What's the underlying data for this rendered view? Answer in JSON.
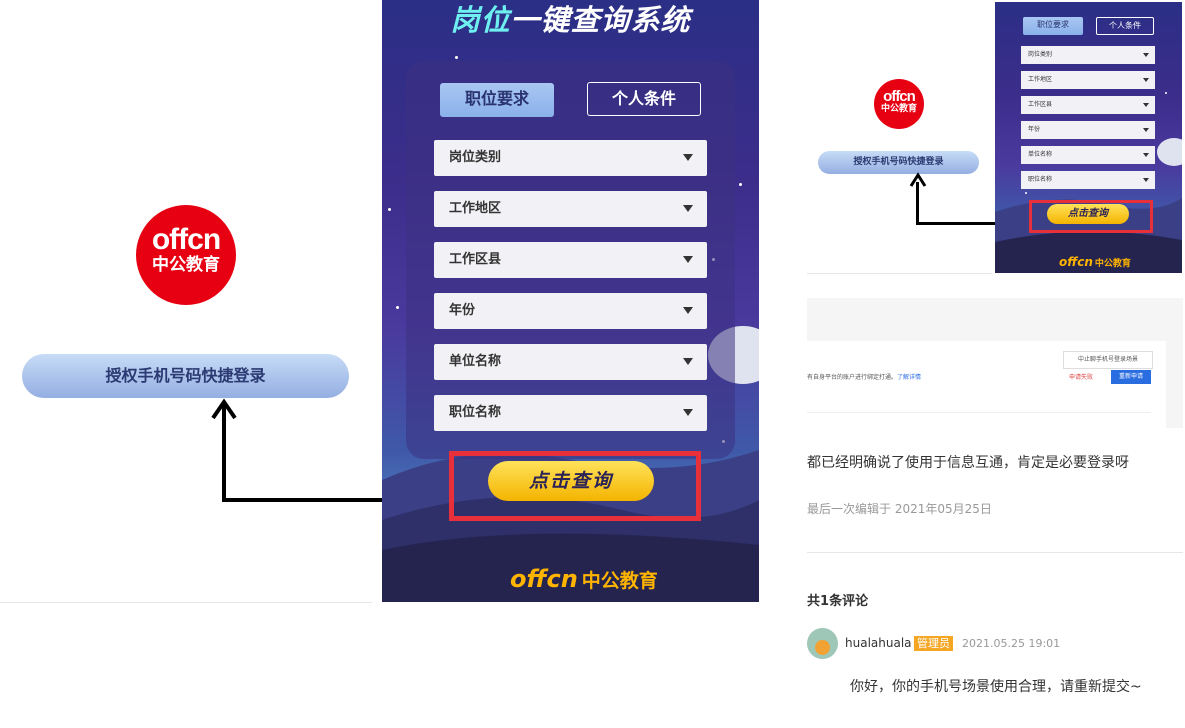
{
  "left": {
    "logo_en": "offcn",
    "logo_cn": "中公教育",
    "auth_label": "授权手机号码快捷登录"
  },
  "phone": {
    "title_highlight": "岗位",
    "title_rest": "一键查询系统",
    "tabs": [
      "职位要求",
      "个人条件"
    ],
    "selects": [
      "岗位类别",
      "工作地区",
      "工作区县",
      "年份",
      "单位名称",
      "职位名称"
    ],
    "query_label": "点击查询",
    "bottom_logo_en": "offcn",
    "bottom_logo_cn": "中公教育"
  },
  "thumb": {
    "logo_en": "offcn",
    "logo_cn": "中公教育",
    "auth_label": "授权手机号码快捷登录",
    "tabs": [
      "职位要求",
      "个人条件"
    ],
    "selects": [
      "岗位类别",
      "工作地区",
      "工作区县",
      "年份",
      "单位名称",
      "职位名称"
    ],
    "query_label": "点击查询",
    "bottom_logo_en": "offcn",
    "bottom_logo_cn": "中公教育"
  },
  "embed": {
    "row_text": "有自身平台的账户进行绑定打通。",
    "link_text": "了解详情",
    "tooltip": "中止聊手机号登录场景",
    "status": "申请失败",
    "reapply": "重新申请"
  },
  "post": {
    "text": "都已经明确说了使用于信息互通，肯定是必要登录呀",
    "edit_info": "最后一次编辑于  2021年05月25日"
  },
  "comments": {
    "title_prefix": "共",
    "count": "1",
    "title_suffix": "条评论",
    "user": "hualahuala",
    "badge": "管理员",
    "time": "2021.05.25 19:01",
    "text": "你好，你的手机号场景使用合理，请重新提交~"
  },
  "colors": {
    "brand_red": "#e60012",
    "highlight_red": "#e8303b",
    "query_yellow": "#f4b400",
    "badge_orange": "#f5a623"
  }
}
